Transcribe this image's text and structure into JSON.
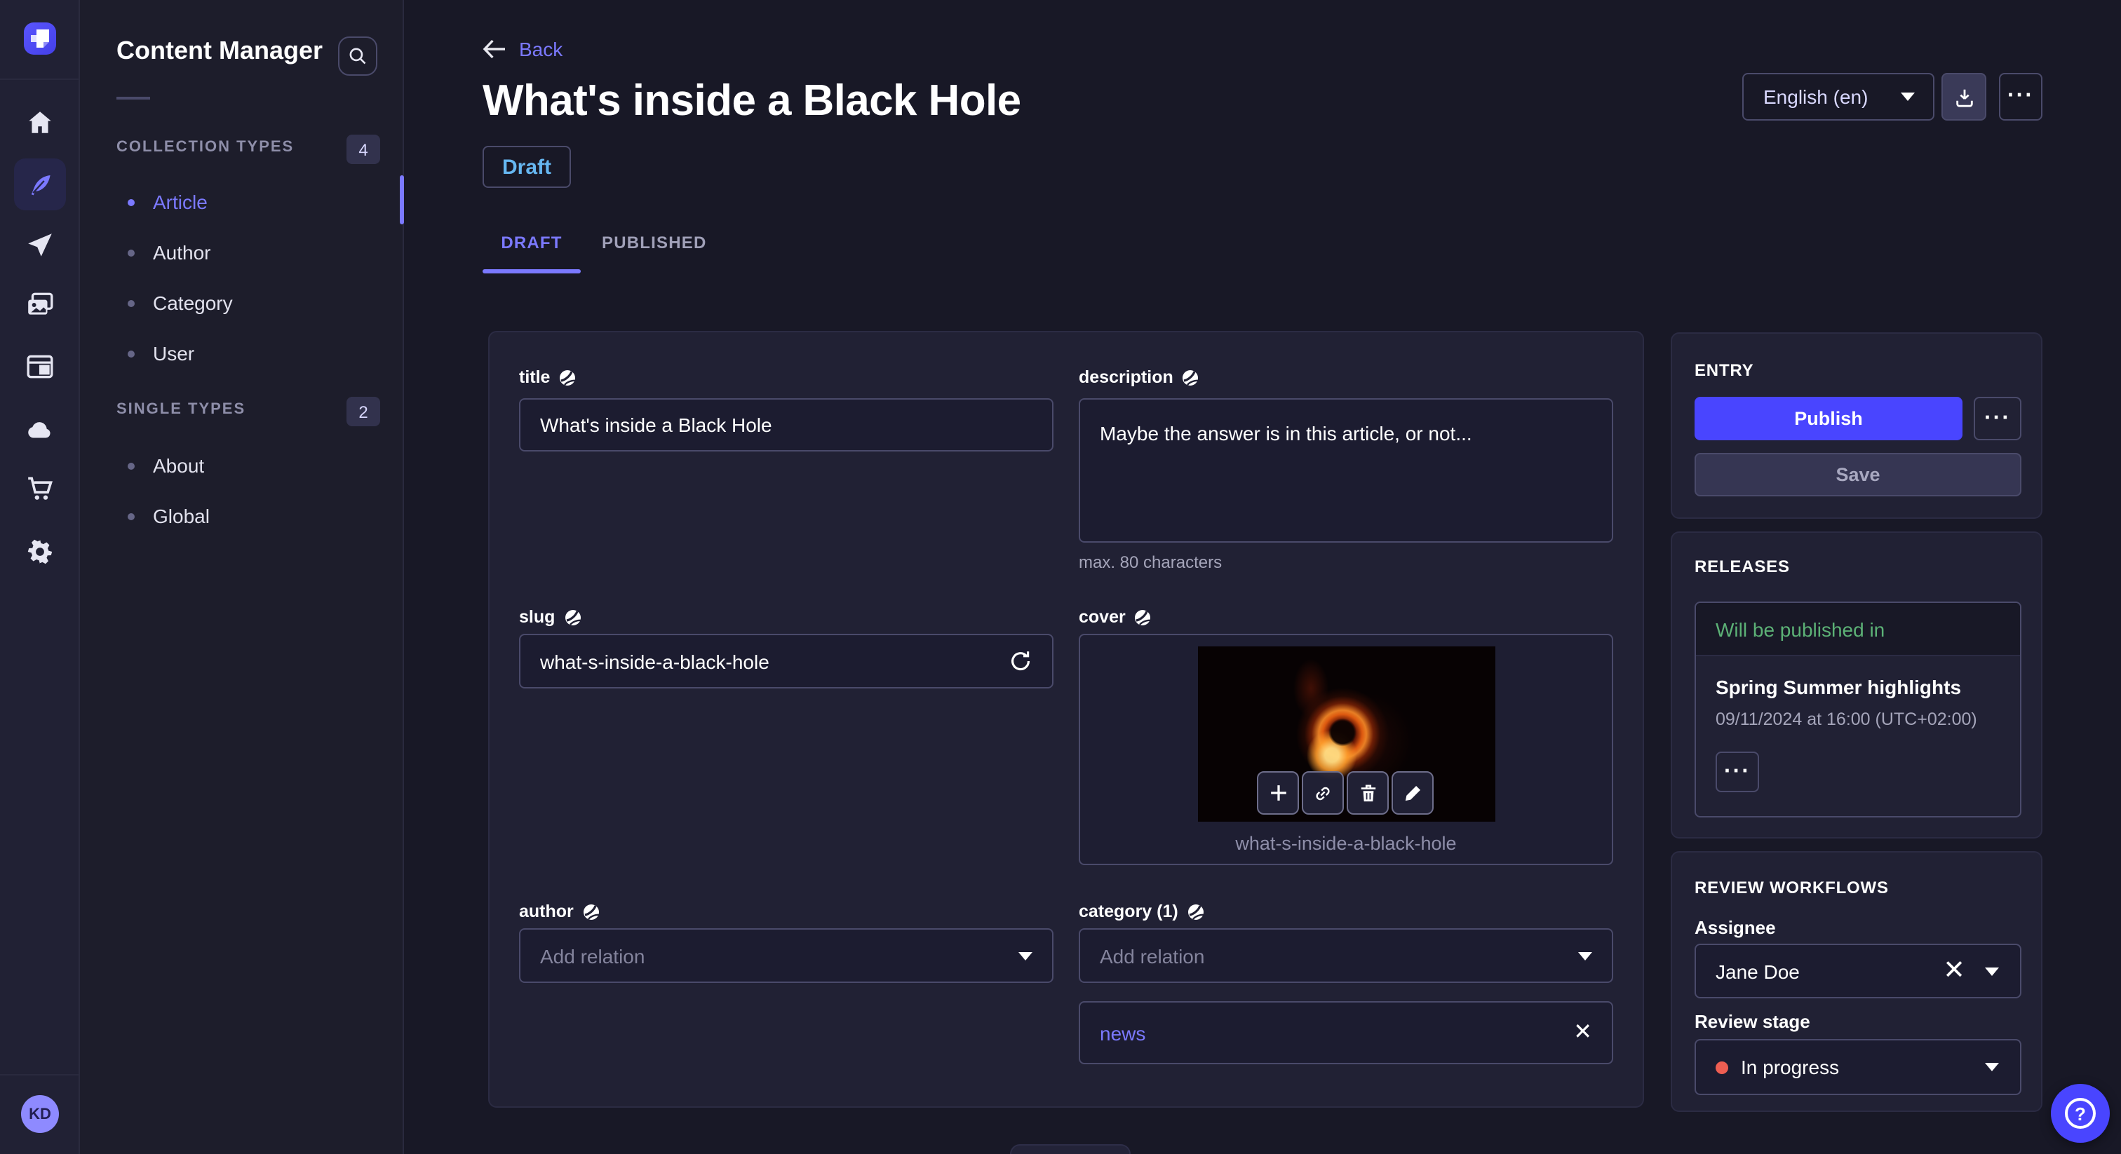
{
  "iconbar": {
    "avatar_initials": "KD"
  },
  "subnav": {
    "title": "Content Manager",
    "sections": [
      {
        "label": "COLLECTION TYPES",
        "count": "4",
        "items": [
          {
            "label": "Article"
          },
          {
            "label": "Author"
          },
          {
            "label": "Category"
          },
          {
            "label": "User"
          }
        ]
      },
      {
        "label": "SINGLE TYPES",
        "count": "2",
        "items": [
          {
            "label": "About"
          },
          {
            "label": "Global"
          }
        ]
      }
    ]
  },
  "header": {
    "back_label": "Back",
    "title": "What's inside a Black Hole",
    "status_badge": "Draft",
    "tabs": {
      "draft": "DRAFT",
      "published": "PUBLISHED"
    },
    "locale": "English (en)",
    "more_icon": "···"
  },
  "form": {
    "fields": {
      "title": {
        "label": "title",
        "value": "What's inside a Black Hole"
      },
      "description": {
        "label": "description",
        "value": "Maybe the answer is in this article, or not...",
        "hint": "max. 80 characters"
      },
      "slug": {
        "label": "slug",
        "value": "what-s-inside-a-black-hole"
      },
      "cover": {
        "label": "cover",
        "filename": "what-s-inside-a-black-hole"
      },
      "author": {
        "label": "author",
        "placeholder": "Add relation"
      },
      "category": {
        "label": "category (1)",
        "placeholder": "Add relation",
        "relation": "news"
      }
    }
  },
  "entry_panel": {
    "title": "ENTRY",
    "publish_label": "Publish",
    "save_label": "Save",
    "more_icon": "···"
  },
  "releases_panel": {
    "title": "RELEASES",
    "status": "Will be published in",
    "release_name": "Spring Summer highlights",
    "release_date": "09/11/2024 at 16:00 (UTC+02:00)",
    "more_icon": "···"
  },
  "review_panel": {
    "title": "REVIEW WORKFLOWS",
    "assignee_label": "Assignee",
    "assignee_value": "Jane Doe",
    "stage_label": "Review stage",
    "stage_value": "In progress"
  },
  "help": {
    "icon": "?"
  },
  "colors": {
    "primary": "#4945ff",
    "primary_light": "#7b79ff",
    "draft_blue": "#66b7f1",
    "success_green": "#5cb176",
    "danger_red": "#ee5e52",
    "page_bg": "#181826",
    "panel_bg": "#212134"
  }
}
